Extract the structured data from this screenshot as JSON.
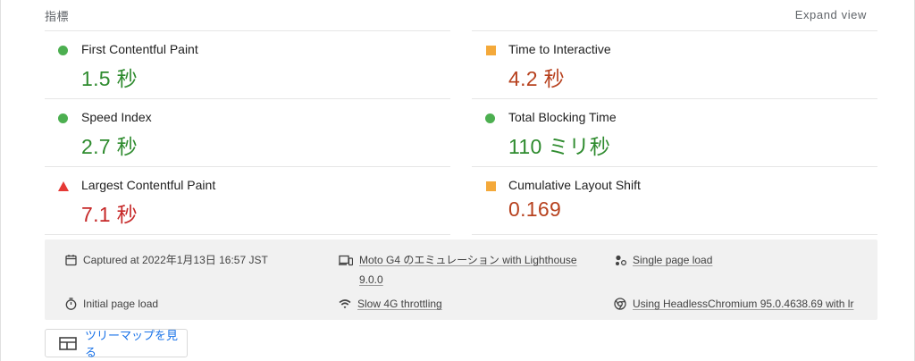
{
  "header": {
    "section_title": "指標",
    "expand_view": "Expand view"
  },
  "metrics": [
    {
      "label": "First Contentful Paint",
      "value": "1.5 秒",
      "status": "pass"
    },
    {
      "label": "Time to Interactive",
      "value": "4.2 秒",
      "status": "average"
    },
    {
      "label": "Speed Index",
      "value": "2.7 秒",
      "status": "pass"
    },
    {
      "label": "Total Blocking Time",
      "value": "110 ミリ秒",
      "status": "pass"
    },
    {
      "label": "Largest Contentful Paint",
      "value": "7.1 秒",
      "status": "fail"
    },
    {
      "label": "Cumulative Layout Shift",
      "value": "0.169",
      "status": "average"
    }
  ],
  "runtime_info": {
    "captured": "Captured at 2022年1月13日 16:57 JST",
    "device_line1": "Moto G4 のエミュレーション with Lighthouse",
    "device_line2": "9.0.0",
    "page_load_type": "Single page load",
    "initial_load": "Initial page load",
    "throttling": "Slow 4G throttling",
    "browser": "Using HeadlessChromium 95.0.4638.69 with lr"
  },
  "treemap": {
    "label": "ツリーマップを見る"
  },
  "colors": {
    "pass": "#2e8b2e",
    "average": "#b7411e",
    "fail": "#c62828",
    "link": "#1a73e8"
  },
  "icons": {
    "pass": "circle-icon",
    "average": "square-icon",
    "fail": "triangle-icon",
    "calendar": "calendar-icon",
    "device": "devices-icon",
    "page_load": "nodes-icon",
    "timer": "timer-icon",
    "network": "wifi-icon",
    "browser": "chrome-icon",
    "treemap": "treemap-icon"
  }
}
